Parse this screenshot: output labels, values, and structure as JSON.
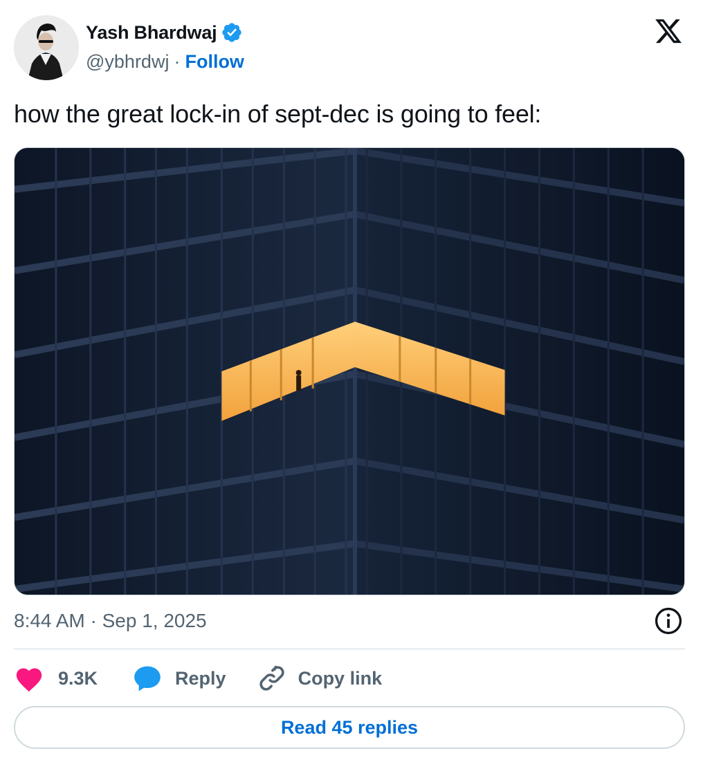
{
  "author": {
    "name": "Yash Bhardwaj",
    "handle": "@ybhrdwj",
    "separator": "·",
    "follow_label": "Follow",
    "verified": true,
    "avatar_icon": "profile-photo"
  },
  "brand": {
    "logo_icon": "x-logo"
  },
  "tweet": {
    "text": "how the great lock-in of sept-dec is going to feel:",
    "media_description_icon": "building-night-photo",
    "timestamp": "8:44 AM · Sep 1, 2025"
  },
  "actions": {
    "like_count": "9.3K",
    "reply_label": "Reply",
    "copy_link_label": "Copy link"
  },
  "footer": {
    "read_replies_label": "Read 45 replies"
  },
  "colors": {
    "accent": "#006fd6",
    "like": "#f91880",
    "reply_icon": "#1d9bf0",
    "verified": "#1d9bf0",
    "secondary_text": "#536471",
    "border": "#cfd9de"
  }
}
